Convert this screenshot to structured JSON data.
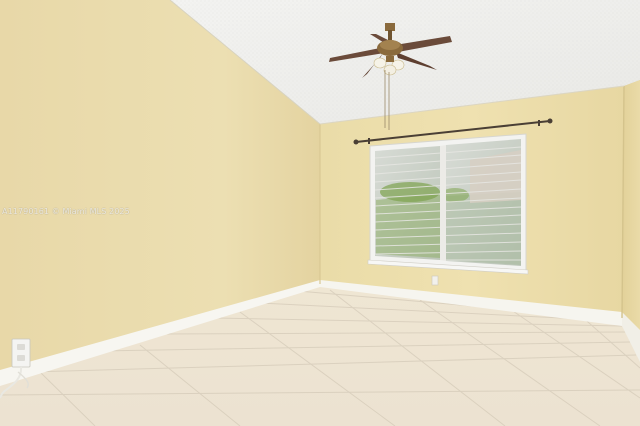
{
  "photo": {
    "watermark": "A11790161 © Miami MLS 2025"
  },
  "colors": {
    "left_wall": "#eadcae",
    "back_wall": "#eddfad",
    "right_wall": "#e6d8a4",
    "ceiling": "#f1f1ee",
    "floor": "#eee5d6",
    "baseboard": "#f7f6f1",
    "window_frame": "#f3f3f1",
    "fan_metal": "#8a6a3c"
  }
}
